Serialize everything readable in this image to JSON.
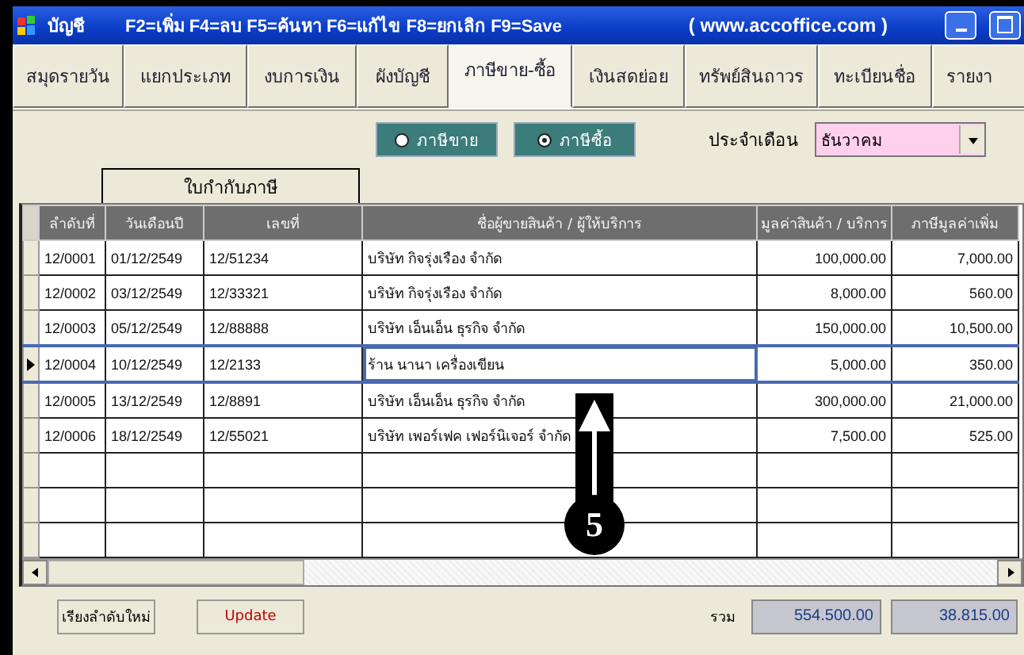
{
  "window": {
    "title": "บัญชี",
    "shortcuts": "F2=เพิ่ม F4=ลบ F5=ค้นหา F6=แก้ไข F8=ยกเลิก F9=Save",
    "website": "( www.accoffice.com )"
  },
  "tabs": [
    {
      "label": "สมุดรายวัน",
      "selected": false
    },
    {
      "label": "แยกประเภท",
      "selected": false
    },
    {
      "label": "งบการเงิน",
      "selected": false
    },
    {
      "label": "ผังบัญชี",
      "selected": false
    },
    {
      "label": "ภาษีขาย-ซื้อ",
      "selected": true
    },
    {
      "label": "เงินสดย่อย",
      "selected": false
    },
    {
      "label": "ทรัพย์สินถาวร",
      "selected": false
    },
    {
      "label": "ทะเบียนชื่อ",
      "selected": false
    },
    {
      "label": "รายงา",
      "selected": false
    }
  ],
  "tax_type": [
    {
      "label": "ภาษีขาย",
      "selected": false
    },
    {
      "label": "ภาษีซื้อ",
      "selected": true
    }
  ],
  "month": {
    "label": "ประจำเดือน",
    "value": "ธันวาคม"
  },
  "table": {
    "group_header": "ใบกำกับภาษี",
    "columns": [
      "ลำดับที่",
      "วันเดือนปี",
      "เลขที่",
      "ชื่อผู้ขายสินค้า / ผู้ให้บริการ",
      "มูลค่าสินค้า / บริการ",
      "ภาษีมูลค่าเพิ่ม"
    ],
    "rows": [
      {
        "cells": [
          "12/0001",
          "01/12/2549",
          "12/51234",
          "บริษัท กิจรุ่งเรือง จำกัด",
          "100,000.00",
          "7,000.00"
        ],
        "selected": false
      },
      {
        "cells": [
          "12/0002",
          "03/12/2549",
          "12/33321",
          "บริษัท กิจรุ่งเรือง จำกัด",
          "8,000.00",
          "560.00"
        ],
        "selected": false
      },
      {
        "cells": [
          "12/0003",
          "05/12/2549",
          "12/88888",
          "บริษัท เอ็นเอ็น ธุรกิจ จำกัด",
          "150,000.00",
          "10,500.00"
        ],
        "selected": false
      },
      {
        "cells": [
          "12/0004",
          "10/12/2549",
          "12/2133",
          "ร้าน นานา เครื่องเขียน",
          "5,000.00",
          "350.00"
        ],
        "selected": true
      },
      {
        "cells": [
          "12/0005",
          "13/12/2549",
          "12/8891",
          "บริษัท เอ็นเอ็น ธุรกิจ จำกัด",
          "300,000.00",
          "21,000.00"
        ],
        "selected": false
      },
      {
        "cells": [
          "12/0006",
          "18/12/2549",
          "12/55021",
          "บริษัท เพอร์เฟค เฟอร์นิเจอร์ จำกัด",
          "7,500.00",
          "525.00"
        ],
        "selected": false
      }
    ]
  },
  "buttons": [
    {
      "label": "เรียงลำดับใหม่",
      "kind": "normal"
    },
    {
      "label": "Update",
      "kind": "accent"
    }
  ],
  "totals": {
    "label": "รวม",
    "values": [
      "554.500.00",
      "38.815.00"
    ]
  },
  "annotation": {
    "number": "5"
  }
}
